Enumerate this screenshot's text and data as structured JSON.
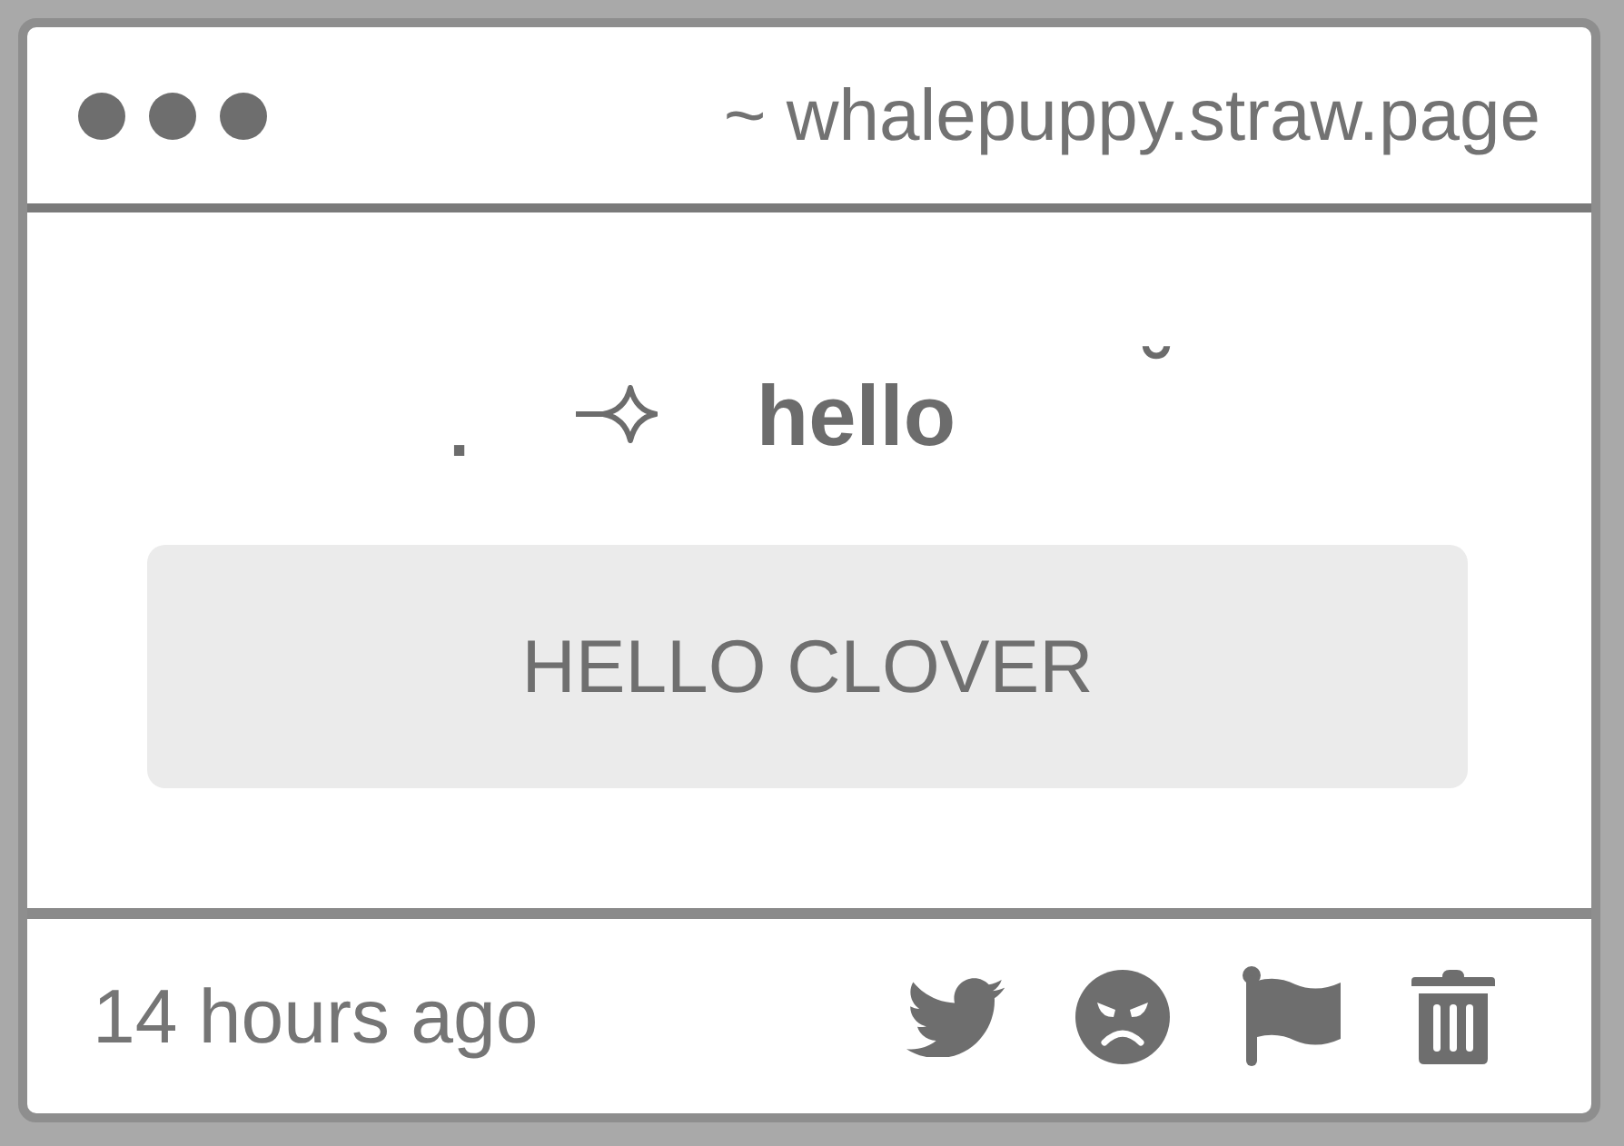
{
  "window": {
    "url": "~ whalepuppy.straw.page"
  },
  "greeting": {
    "prefix": ".",
    "text": "hello",
    "suffix": "˘"
  },
  "message": {
    "text": "HELLO CLOVER"
  },
  "footer": {
    "time": "14 hours ago",
    "actions": [
      {
        "kind": "bird"
      },
      {
        "kind": "angry"
      },
      {
        "kind": "flag"
      },
      {
        "kind": "trash"
      }
    ]
  }
}
